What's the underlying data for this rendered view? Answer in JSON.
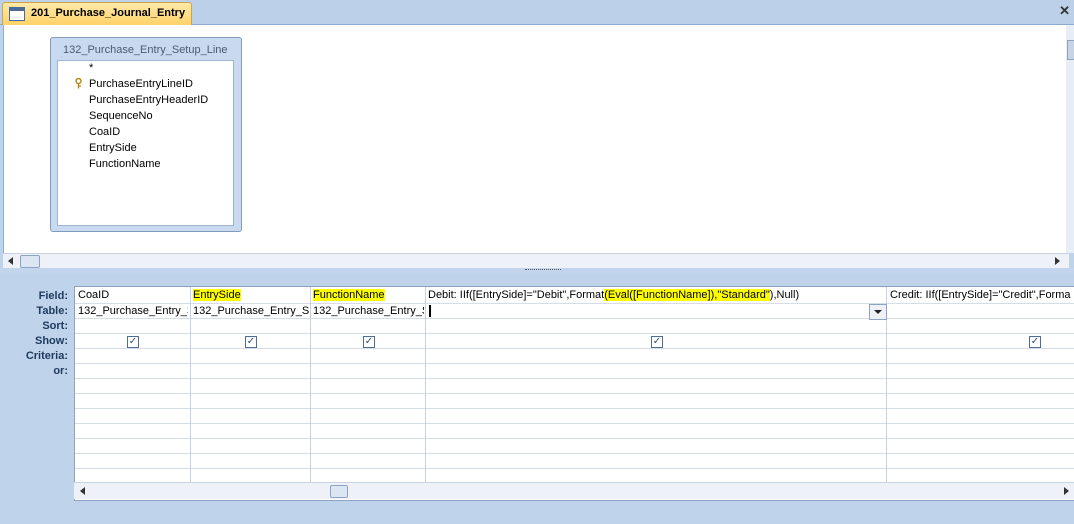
{
  "tab": {
    "label": "201_Purchase_Journal_Entry"
  },
  "table": {
    "title": "132_Purchase_Entry_Setup_Line",
    "fields": [
      "*",
      "PurchaseEntryLineID",
      "PurchaseEntryHeaderID",
      "SequenceNo",
      "CoaID",
      "EntrySide",
      "FunctionName"
    ]
  },
  "grid": {
    "row_labels": {
      "field": "Field:",
      "table": "Table:",
      "sort": "Sort:",
      "show": "Show:",
      "criteria": "Criteria:",
      "or": "or:"
    },
    "columns": [
      {
        "field": "CoaID",
        "table": "132_Purchase_Entry_S",
        "show": true
      },
      {
        "field": "EntrySide",
        "table": "132_Purchase_Entry_Se",
        "show": true
      },
      {
        "field": "FunctionName",
        "table": "132_Purchase_Entry_S",
        "show": true
      },
      {
        "field_pre": "Debit: IIf([EntrySide]=\"Debit\",Format",
        "field_hl": "(Eval([FunctionName]),\"Standard\"",
        "field_post": "),Null)",
        "table": "",
        "show": true
      },
      {
        "field": "Credit: IIf([EntrySide]=\"Credit\",Forma",
        "table": "",
        "show": true
      }
    ]
  }
}
